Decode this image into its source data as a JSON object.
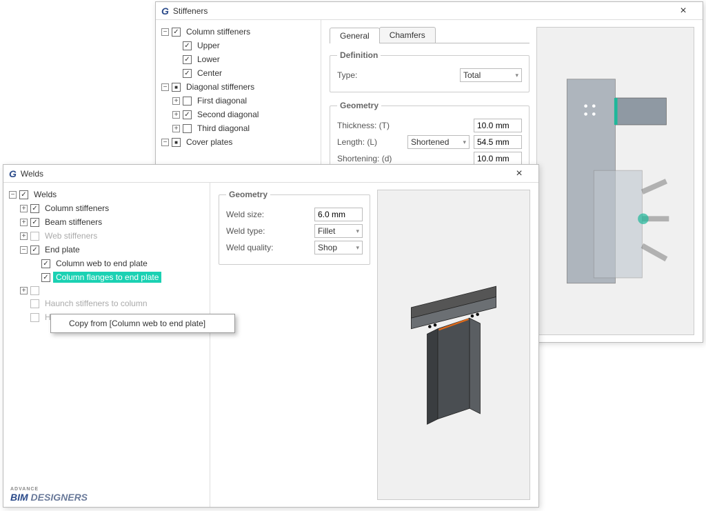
{
  "stiffeners_window": {
    "title": "Stiffeners",
    "tree": {
      "root": "Column stiffeners",
      "upper": "Upper",
      "lower": "Lower",
      "center": "Center",
      "diag_root": "Diagonal stiffeners",
      "diag1": "First diagonal",
      "diag2": "Second diagonal",
      "diag3": "Third diagonal",
      "cover": "Cover plates"
    },
    "tabs": {
      "general": "General",
      "chamfers": "Chamfers"
    },
    "definition": {
      "legend": "Definition",
      "type_label": "Type:",
      "type_value": "Total"
    },
    "geometry": {
      "legend": "Geometry",
      "thickness_label": "Thickness: (T)",
      "thickness_value": "10.0 mm",
      "length_label": "Length: (L)",
      "length_mode": "Shortened",
      "length_value": "54.5 mm",
      "short_label": "Shortening: (d)",
      "short_value": "10.0 mm"
    }
  },
  "welds_window": {
    "title": "Welds",
    "tree": {
      "root": "Welds",
      "col_stiff": "Column stiffeners",
      "beam_stiff": "Beam stiffeners",
      "web_stiff": "Web stiffeners",
      "end_plate": "End plate",
      "col_web_ep": "Column web to end plate",
      "col_flg_ep": "Column flanges to end plate",
      "blank_item": "",
      "haunch_col": "Haunch stiffeners to column",
      "haunch_beam": "Haunch stiffeners to beam"
    },
    "context_menu": "Copy from [Column web to end plate]",
    "geometry": {
      "legend": "Geometry",
      "size_label": "Weld size:",
      "size_value": "6.0 mm",
      "type_label": "Weld type:",
      "type_value": "Fillet",
      "quality_label": "Weld quality:",
      "quality_value": "Shop"
    }
  },
  "logo": {
    "advance": "ADVANCE",
    "bim": "BIM",
    "designers": " DESIGNERS"
  }
}
